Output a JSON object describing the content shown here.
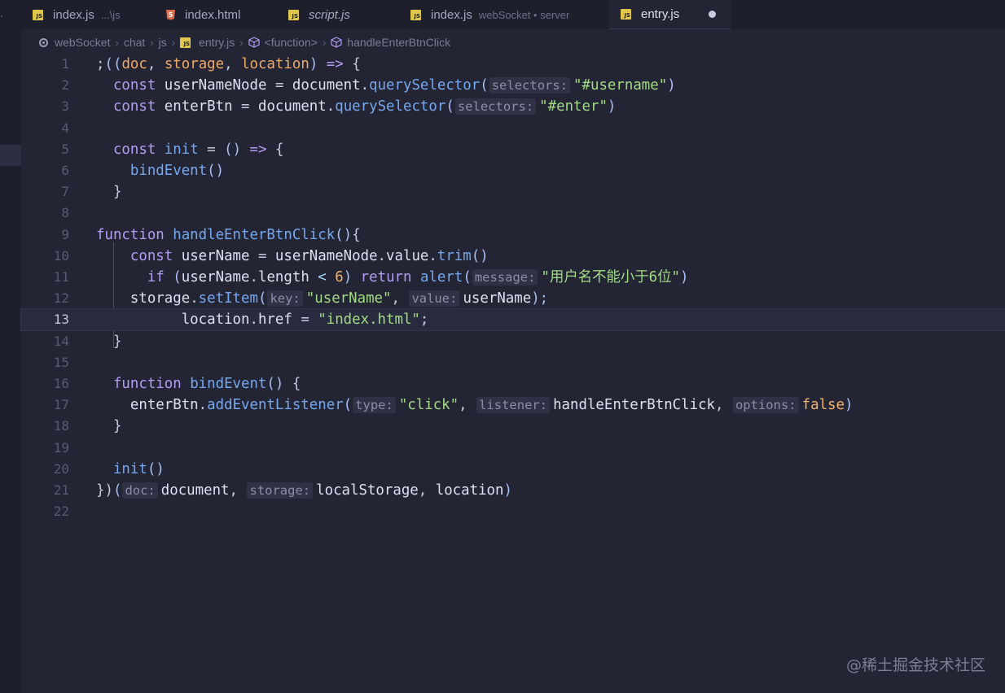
{
  "tabs": [
    {
      "name": "index.js",
      "desc": "...\\js",
      "icon": "js-file-icon"
    },
    {
      "name": "index.html",
      "desc": "",
      "icon": "html-file-icon"
    },
    {
      "name": "script.js",
      "desc": "",
      "icon": "js-file-icon"
    },
    {
      "name": "index.js",
      "desc": "webSocket • server",
      "icon": "js-file-icon"
    },
    {
      "name": "entry.js",
      "desc": "",
      "icon": "js-file-icon",
      "active": true,
      "modified": true
    }
  ],
  "breadcrumb": {
    "root": "webSocket",
    "dir1": "chat",
    "dir2": "js",
    "file": "entry.js",
    "scope": "<function>",
    "symbol": "handleEnterBtnClick"
  },
  "editor": {
    "current_line": 13,
    "line_numbers": [
      "1",
      "2",
      "3",
      "4",
      "5",
      "6",
      "7",
      "8",
      "9",
      "10",
      "11",
      "12",
      "13",
      "14",
      "15",
      "16",
      "17",
      "18",
      "19",
      "20",
      "21",
      "22"
    ],
    "lines": [
      [
        [
          ";",
          "punc"
        ],
        [
          "((",
          "paren"
        ],
        [
          "doc",
          "prm"
        ],
        [
          ", ",
          "punc"
        ],
        [
          "storage",
          "prm"
        ],
        [
          ", ",
          "punc"
        ],
        [
          "location",
          "prm"
        ],
        [
          ") ",
          "paren"
        ],
        [
          "=> ",
          "kw"
        ],
        [
          "{",
          "punc"
        ]
      ],
      [
        [
          "  "
        ],
        [
          "const ",
          "kw"
        ],
        [
          "userNameNode ",
          "var"
        ],
        [
          "= ",
          "punc"
        ],
        [
          "document",
          "var"
        ],
        [
          ".",
          "punc"
        ],
        [
          "querySelector",
          "fn"
        ],
        [
          "(",
          "paren"
        ],
        [
          "selectors:",
          "hint"
        ],
        [
          "\"#username\"",
          "str"
        ],
        [
          ")",
          "paren"
        ]
      ],
      [
        [
          "  "
        ],
        [
          "const ",
          "kw"
        ],
        [
          "enterBtn ",
          "var"
        ],
        [
          "= ",
          "punc"
        ],
        [
          "document",
          "var"
        ],
        [
          ".",
          "punc"
        ],
        [
          "querySelector",
          "fn"
        ],
        [
          "(",
          "paren"
        ],
        [
          "selectors:",
          "hint"
        ],
        [
          "\"#enter\"",
          "str"
        ],
        [
          ")",
          "paren"
        ]
      ],
      [],
      [
        [
          "  "
        ],
        [
          "const ",
          "kw"
        ],
        [
          "init ",
          "fn"
        ],
        [
          "= ",
          "punc"
        ],
        [
          "() ",
          "paren"
        ],
        [
          "=> ",
          "kw"
        ],
        [
          "{",
          "punc"
        ]
      ],
      [
        [
          "    "
        ],
        [
          "bindEvent",
          "fn"
        ],
        [
          "()",
          "paren"
        ]
      ],
      [
        [
          "  "
        ],
        [
          "}",
          "punc"
        ]
      ],
      [],
      [
        [
          "function ",
          "kw"
        ],
        [
          "handleEnterBtnClick",
          "fn"
        ],
        [
          "()",
          "paren"
        ],
        [
          "{",
          "punc"
        ]
      ],
      [
        [
          "    "
        ],
        [
          "const ",
          "kw"
        ],
        [
          "userName ",
          "var"
        ],
        [
          "= ",
          "punc"
        ],
        [
          "userNameNode",
          "var"
        ],
        [
          ".",
          "punc"
        ],
        [
          "value",
          "var"
        ],
        [
          ".",
          "punc"
        ],
        [
          "trim",
          "fn"
        ],
        [
          "()",
          "paren"
        ]
      ],
      [
        [
          "      "
        ],
        [
          "if ",
          "kw"
        ],
        [
          "(",
          "paren"
        ],
        [
          "userName",
          "var"
        ],
        [
          ".",
          "punc"
        ],
        [
          "length ",
          "var"
        ],
        [
          "< ",
          "op"
        ],
        [
          "6",
          "num"
        ],
        [
          ") ",
          "paren"
        ],
        [
          "return ",
          "kw"
        ],
        [
          "alert",
          "fn"
        ],
        [
          "(",
          "paren"
        ],
        [
          "message:",
          "hint"
        ],
        [
          "\"用户名不能小于6位\"",
          "str"
        ],
        [
          ")",
          "paren"
        ]
      ],
      [
        [
          "    "
        ],
        [
          "storage",
          "var"
        ],
        [
          ".",
          "punc"
        ],
        [
          "setItem",
          "fn"
        ],
        [
          "(",
          "paren"
        ],
        [
          "key:",
          "hint"
        ],
        [
          "\"userName\"",
          "str"
        ],
        [
          ", ",
          "punc"
        ],
        [
          "value:",
          "hint"
        ],
        [
          "userName",
          "var"
        ],
        [
          ");",
          "paren"
        ]
      ],
      [
        [
          "          "
        ],
        [
          "location",
          "var"
        ],
        [
          ".",
          "punc"
        ],
        [
          "href ",
          "var"
        ],
        [
          "= ",
          "punc"
        ],
        [
          "\"index.html\"",
          "str"
        ],
        [
          ";",
          "punc"
        ]
      ],
      [
        [
          "  "
        ],
        [
          "}",
          "punc"
        ]
      ],
      [],
      [
        [
          "  "
        ],
        [
          "function ",
          "kw"
        ],
        [
          "bindEvent",
          "fn"
        ],
        [
          "() ",
          "paren"
        ],
        [
          "{",
          "punc"
        ]
      ],
      [
        [
          "    "
        ],
        [
          "enterBtn",
          "var"
        ],
        [
          ".",
          "punc"
        ],
        [
          "addEventListener",
          "fn"
        ],
        [
          "(",
          "paren"
        ],
        [
          "type:",
          "hint"
        ],
        [
          "\"click\"",
          "str"
        ],
        [
          ", ",
          "punc"
        ],
        [
          "listener:",
          "hint"
        ],
        [
          "handleEnterBtnClick",
          "var"
        ],
        [
          ", ",
          "punc"
        ],
        [
          "options:",
          "hint"
        ],
        [
          "false",
          "num"
        ],
        [
          ")",
          "paren"
        ]
      ],
      [
        [
          "  "
        ],
        [
          "}",
          "punc"
        ]
      ],
      [],
      [
        [
          "  "
        ],
        [
          "init",
          "fn"
        ],
        [
          "()",
          "paren"
        ]
      ],
      [
        [
          "})",
          "punc"
        ],
        [
          "(",
          "paren"
        ],
        [
          "doc:",
          "hint"
        ],
        [
          "document",
          "var"
        ],
        [
          ", ",
          "punc"
        ],
        [
          "storage:",
          "hint"
        ],
        [
          "localStorage",
          "var"
        ],
        [
          ", ",
          "punc"
        ],
        [
          "location",
          "var"
        ],
        [
          ")",
          "paren"
        ]
      ],
      []
    ]
  },
  "watermark": "@稀土掘金技术社区",
  "colors": {
    "background": "#232534",
    "tabbar": "#1d1f2c",
    "keyword": "#b39df3",
    "function": "#77a8ee",
    "string": "#a3da86",
    "param": "#f0a968"
  }
}
